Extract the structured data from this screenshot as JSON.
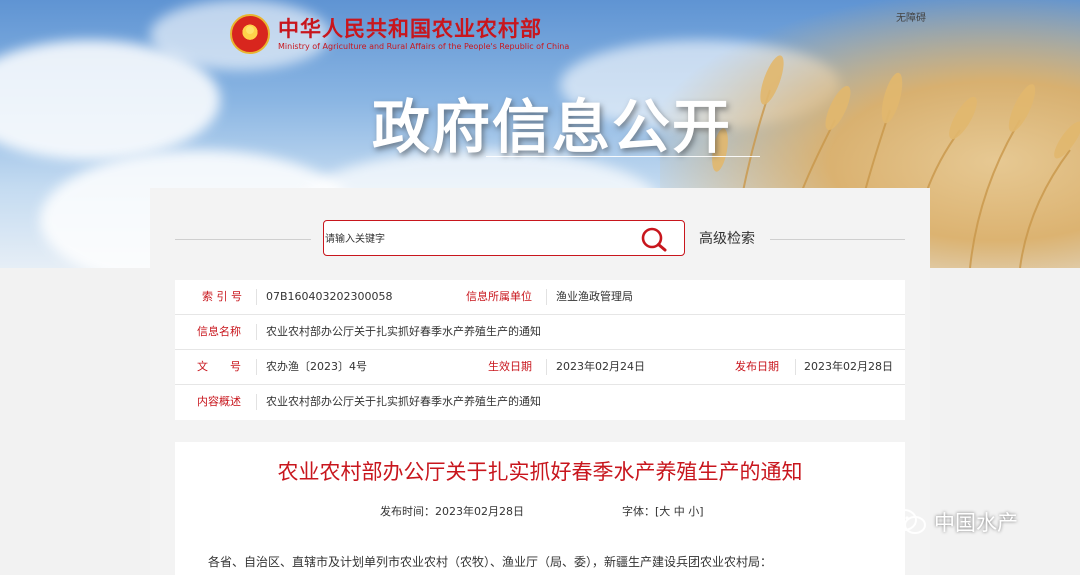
{
  "header": {
    "ministry_cn": "中华人民共和国农业农村部",
    "ministry_en": "Ministry of Agriculture and Rural Affairs of the People's Republic of China",
    "accessibility": "无障碍",
    "banner_title": "政府信息公开"
  },
  "search": {
    "placeholder": "请输入关键字",
    "advanced_label": "高级检索",
    "icon": "search-icon"
  },
  "info": {
    "index_label": "索 引 号",
    "index_value": "07B160403202300058",
    "unit_label": "信息所属单位",
    "unit_value": "渔业渔政管理局",
    "name_label": "信息名称",
    "name_value": "农业农村部办公厅关于扎实抓好春季水产养殖生产的通知",
    "doc_no_label": "文　　号",
    "doc_no_value": "农办渔〔2023〕4号",
    "effective_label": "生效日期",
    "effective_value": "2023年02月24日",
    "publish_label": "发布日期",
    "publish_value": "2023年02月28日",
    "summary_label": "内容概述",
    "summary_value": "农业农村部办公厅关于扎实抓好春季水产养殖生产的通知"
  },
  "document": {
    "title": "农业农村部办公厅关于扎实抓好春季水产养殖生产的通知",
    "publish_time_label": "发布时间：",
    "publish_time_value": "2023年02月28日",
    "font_label": "字体：",
    "font_open": "[",
    "font_large": "大",
    "font_medium": "中",
    "font_small": "小",
    "font_close": "]",
    "body_first_line": "各省、自治区、直辖市及计划单列市农业农村（农牧）、渔业厅（局、委），新疆生产建设兵团农业农村局："
  },
  "watermark": {
    "text": "中国水产",
    "icon": "wechat-icon"
  },
  "colors": {
    "accent": "#c8161d",
    "panel_bg": "#f3f3f3",
    "text": "#333333"
  }
}
